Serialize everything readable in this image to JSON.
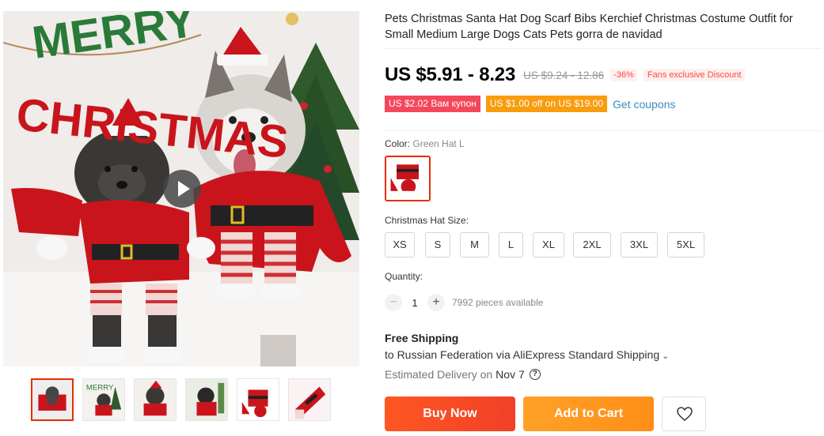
{
  "product": {
    "title": "Pets Christmas Santa Hat Dog Scarf Bibs Kerchief Christmas Costume Outfit for Small Medium Large Dogs Cats Pets gorra de navidad",
    "price": "US $5.91 - 8.23",
    "original_price": "US $9.24 - 12.86",
    "discount": "-36%",
    "fans_discount": "Fans exclusive Discount"
  },
  "gallery": {
    "banner_text": "MERRY CHRISTMAS",
    "play_icon": "play-icon",
    "thumbnails": [
      "thumb-1",
      "thumb-2",
      "thumb-3",
      "thumb-4",
      "thumb-5",
      "thumb-6"
    ],
    "active_thumbnail": 1
  },
  "coupons": {
    "items": [
      "US $2.02 Вам купон",
      "US $1.00 off on US $19.00"
    ],
    "get_label": "Get coupons"
  },
  "color": {
    "label": "Color:",
    "selected": "Green Hat L"
  },
  "size": {
    "label": "Christmas Hat Size:",
    "options": [
      "XS",
      "S",
      "M",
      "L",
      "XL",
      "2XL",
      "3XL",
      "5XL"
    ]
  },
  "quantity": {
    "label": "Quantity:",
    "minus": "−",
    "plus": "+",
    "value": "1",
    "stock": "7992 pieces available"
  },
  "shipping": {
    "title": "Free Shipping",
    "to": "to Russian Federation via",
    "method": "AliExpress Standard Shipping",
    "delivery_label": "Estimated Delivery on",
    "delivery_date": "Nov 7",
    "help_icon": "?"
  },
  "actions": {
    "buy_now": "Buy Now",
    "add_to_cart": "Add to Cart",
    "wishlist_icon": "heart-icon"
  },
  "colors": {
    "buy_now": "#f14026",
    "add_to_cart": "#ff8e17",
    "coupon_red": "#f5475a",
    "coupon_orange": "#f99c0e",
    "link": "#3a8cc3",
    "selected_border": "#e62e04"
  }
}
